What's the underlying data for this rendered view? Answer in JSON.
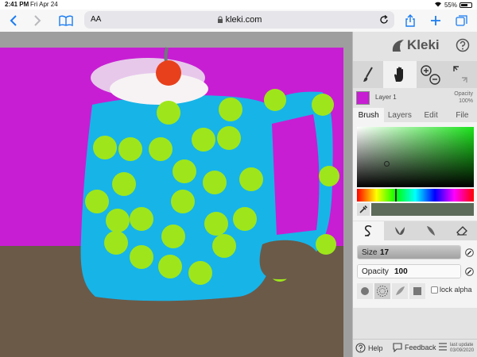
{
  "status_bar": {
    "time": "2:41 PM",
    "date": "Fri Apr 24",
    "battery": "55%",
    "battery_level": 0.55
  },
  "browser": {
    "text_size_label": "AA",
    "address": "kleki.com"
  },
  "app": {
    "brand": "Kleki",
    "layer": {
      "name": "Layer 1",
      "opacity_label": "Opacity",
      "opacity_value": "100%"
    },
    "tabs": [
      "Brush",
      "Layers",
      "Edit",
      "File"
    ],
    "colors": {
      "accent_hue": "#1ce41c",
      "current_color": "#5d6b5b"
    },
    "brush": {
      "size_label": "Size",
      "size_value": "17",
      "size_fraction": 0.17,
      "opacity_label": "Opacity",
      "opacity_value": "100",
      "opacity_fraction": 1.0,
      "lock_alpha_label": "lock alpha"
    },
    "footer": {
      "help": "Help",
      "feedback": "Feedback",
      "last_update_label": "last update",
      "last_update_date": "03/09/2020"
    }
  },
  "canvas_colors": {
    "background": "#c71ed3",
    "table": "#6b5a48",
    "mug": "#17b4e8",
    "dots": "#9ee61b",
    "cherry": "#e8401c"
  }
}
